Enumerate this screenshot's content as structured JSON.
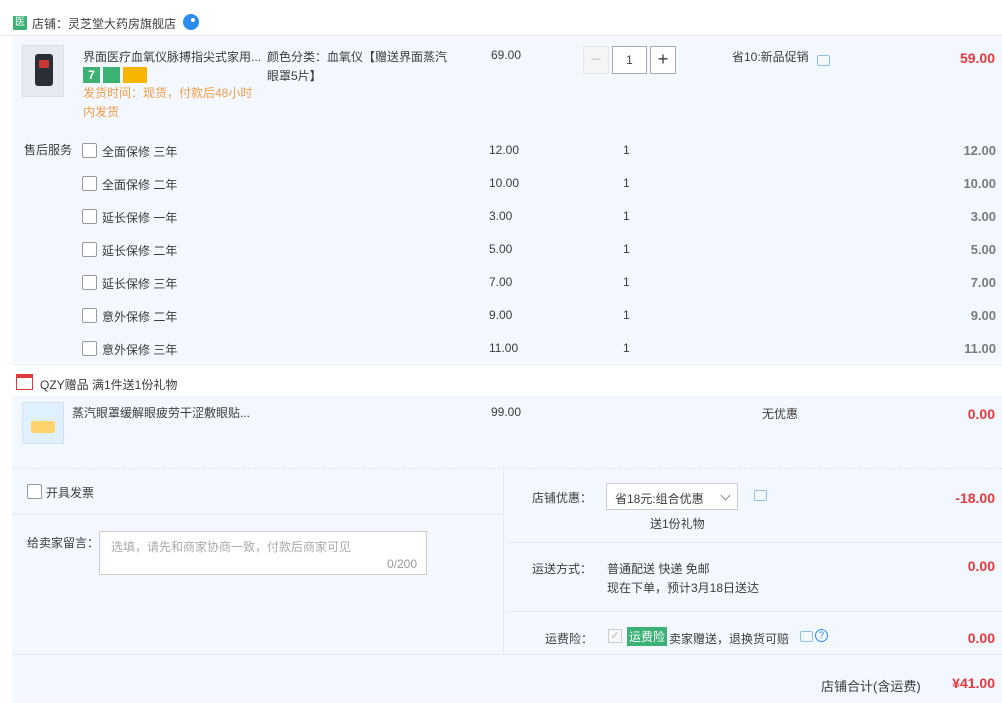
{
  "shop": {
    "badge": "医",
    "name": "店铺：灵芝堂大药房旗舰店"
  },
  "item": {
    "title": "界面医疗血氧仪脉搏指尖式家用...",
    "tags": [
      "7",
      "hand",
      "card"
    ],
    "shipping": "发货时间：现货，付款后48小时内发货",
    "spec": "颜色分类：血氧仪【赠送界面蒸汽眼罩5片】",
    "price": "69.00",
    "qty": "1",
    "qty_minus": "−",
    "qty_plus": "+",
    "promo": "省10:新品促销",
    "subtotal": "59.00"
  },
  "services": {
    "label": "售后服务",
    "rows": [
      {
        "name": "全面保修 三年",
        "price": "12.00",
        "qty": "1",
        "subtotal": "12.00"
      },
      {
        "name": "全面保修 二年",
        "price": "10.00",
        "qty": "1",
        "subtotal": "10.00"
      },
      {
        "name": "延长保修 一年",
        "price": "3.00",
        "qty": "1",
        "subtotal": "3.00"
      },
      {
        "name": "延长保修 二年",
        "price": "5.00",
        "qty": "1",
        "subtotal": "5.00"
      },
      {
        "name": "延长保修 三年",
        "price": "7.00",
        "qty": "1",
        "subtotal": "7.00"
      },
      {
        "name": "意外保修 二年",
        "price": "9.00",
        "qty": "1",
        "subtotal": "9.00"
      },
      {
        "name": "意外保修 三年",
        "price": "11.00",
        "qty": "1",
        "subtotal": "11.00"
      }
    ]
  },
  "gift": {
    "header": "QZY赠品 满1件送1份礼物",
    "title": "蒸汽眼罩缓解眼疲劳干涩敷眼贴...",
    "price": "99.00",
    "promo": "无优惠",
    "subtotal": "0.00"
  },
  "order": {
    "invoice_label": "开具发票",
    "message_label": "给卖家留言：",
    "message_placeholder": "选填，请先和商家协商一致，付款后商家可见",
    "message_count": "0/200",
    "discount_label": "店铺优惠：",
    "discount_value": "省18元:组合优惠",
    "discount_note": "送1份礼物",
    "discount_amount": "-18.00",
    "shipping_label": "运送方式：",
    "shipping_line1": "普通配送 快递 免邮",
    "shipping_line2": "现在下单，预计3月18日送达",
    "shipping_amount": "0.00",
    "insurance_label": "运费险：",
    "insurance_tag": "运费险",
    "insurance_text": "卖家赠送，退换货可赔",
    "insurance_amount": "0.00",
    "total_label": "店铺合计(含运费)",
    "total_amount": "¥41.00"
  },
  "colors": {
    "price_red": "#e4393c",
    "orange": "#f39c4a",
    "light_blue": "#f3f8ff",
    "green": "#3bb273",
    "blue": "#2a8cf0"
  }
}
